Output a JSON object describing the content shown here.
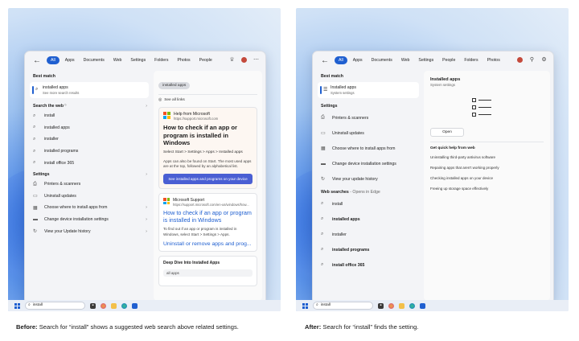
{
  "before": {
    "tabs": [
      "All",
      "Apps",
      "Documents",
      "Web",
      "Settings",
      "Folders",
      "Photos",
      "People"
    ],
    "active_tab": "All",
    "best_match_heading": "Best match",
    "best_match": {
      "title": "installed apps",
      "subtitle": "See more search results"
    },
    "web_heading": "Search the web",
    "web_items": [
      "install",
      "installed apps",
      "installer",
      "installed programs",
      "install office 365"
    ],
    "settings_heading": "Settings",
    "settings_items": [
      "Printers & scanners",
      "Uninstall updates",
      "Choose where to install apps from",
      "Change device installation settings",
      "View your Update history"
    ],
    "preview": {
      "query_pill": "installed apps",
      "see_all_links": "See all links",
      "help_source": "Help from Microsoft",
      "help_url": "https://support.microsoft.com",
      "help_title": "How to check if an app or program is installed in Windows",
      "help_steps": "Select Start > Settings > Apps > Installed apps",
      "help_body": "Apps can also be found on Start. The most used apps are at the top, followed by an alphabetical list.",
      "help_button": "See installed apps and programs on your device",
      "support_source": "Microsoft Support",
      "support_url": "https://support.microsoft.com/en-us/windows/how...",
      "support_title": "How to check if an app or program is installed in Windows",
      "support_body": "To find out if an app or program is installed in Windows, select Start > Settings > Apps.",
      "support_link": "Uninstall or remove apps and prog...",
      "deep_dive": "Deep Dive Into Installed Apps",
      "deep_dive_item": "all apps"
    },
    "taskbar_query": "install",
    "caption_label": "Before:",
    "caption_text": "Search for “install” shows a suggested web search above related settings."
  },
  "after": {
    "tabs": [
      "All",
      "Apps",
      "Documents",
      "Web",
      "Settings",
      "People",
      "Folders",
      "Photos"
    ],
    "active_tab": "All",
    "best_match_heading": "Best match",
    "best_match": {
      "title": "Installed apps",
      "subtitle": "System settings"
    },
    "settings_heading": "Settings",
    "settings_items": [
      "Printers & scanners",
      "Uninstall updates",
      "Choose where to install apps from",
      "Change device installation settings",
      "View your update history"
    ],
    "web_heading": "Web searches",
    "web_sub": "- Opens in Edge",
    "web_items": [
      "install",
      "installed apps",
      "installer",
      "installed programs",
      "install office 365"
    ],
    "preview": {
      "title": "Installed apps",
      "subtitle": "System settings",
      "open_button": "Open",
      "quick_help_heading": "Get quick help from web",
      "quick_help": [
        "Uninstalling third-party antivirus software",
        "Repairing apps that aren't working properly",
        "Checking installed apps on your device",
        "Freeing up storage space effectively"
      ]
    },
    "taskbar_query": "install",
    "caption_label": "After:",
    "caption_text": "Search for “install” finds the setting."
  }
}
